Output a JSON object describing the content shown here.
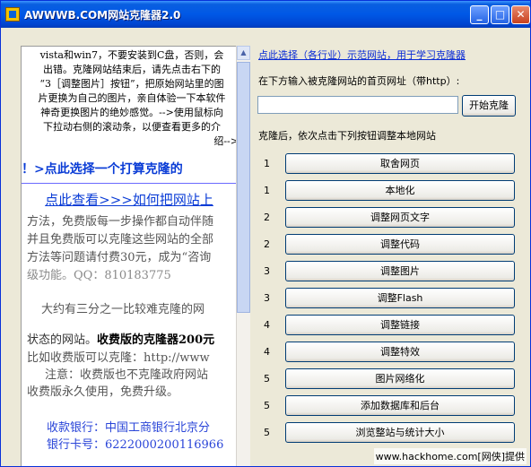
{
  "window": {
    "title": "AWWWB.COM网站克隆器2.0",
    "minimize_symbol": "_",
    "maximize_symbol": "□",
    "close_symbol": "✕"
  },
  "left_panel": {
    "intro_lines": [
      "vista和win7，不要安装到C盘，否则，会",
      "出错。克隆网站结束后，请先点击右下的",
      "“3［调整图片］按钮”，把原始网站里的图",
      "片更换为自己的图片，亲自体验一下本软件",
      "神奇更换图片的绝妙感觉。-->使用鼠标向",
      "下拉动右侧的滚动条，以便查看更多的介",
      "绍-->"
    ],
    "banner": "！>点此选择一个打算克隆的",
    "link": "点此查看>>>如何把网站上",
    "body_lines": [
      "方法，免费版每一步操作都自动伴随",
      "并且免费版可以克隆这些网站的全部",
      "方法等问题请付费30元，成为“咨询",
      "级功能。QQ：810183775"
    ],
    "para2": "大约有三分之一比较难克隆的网",
    "para3_prefix": "状态的网站。",
    "para3_bold": "收费版的克隆器200元",
    "para4_lines": [
      "比如收费版可以克隆：http://www",
      "注意：收费版也不克隆政府网站",
      "收费版永久使用，免费升级。"
    ],
    "para5_lines": [
      "收款银行：中国工商银行北京分",
      "银行卡号：6222000200116966"
    ],
    "scroll_up_symbol": "▲"
  },
  "right_panel": {
    "sample_link": "点此选择（各行业）示范网站，用于学习克隆器",
    "url_prompt": "在下方输入被克隆网站的首页网址（带http）:",
    "url_value": "",
    "start_button": "开始克隆",
    "steps_prompt": "克隆后，依次点击下列按钮调整本地网站",
    "steps": [
      {
        "num": "1",
        "label": "取舍网页"
      },
      {
        "num": "1",
        "label": "本地化"
      },
      {
        "num": "2",
        "label": "调整网页文字"
      },
      {
        "num": "2",
        "label": "调整代码"
      },
      {
        "num": "3",
        "label": "调整图片"
      },
      {
        "num": "3",
        "label": "调整Flash"
      },
      {
        "num": "4",
        "label": "调整链接"
      },
      {
        "num": "4",
        "label": "调整特效"
      },
      {
        "num": "5",
        "label": "图片网络化"
      },
      {
        "num": "5",
        "label": "添加数据库和后台"
      },
      {
        "num": "5",
        "label": "浏览整站与统计大小"
      }
    ]
  },
  "watermark": "www.hackhome.com[网侠]提供"
}
